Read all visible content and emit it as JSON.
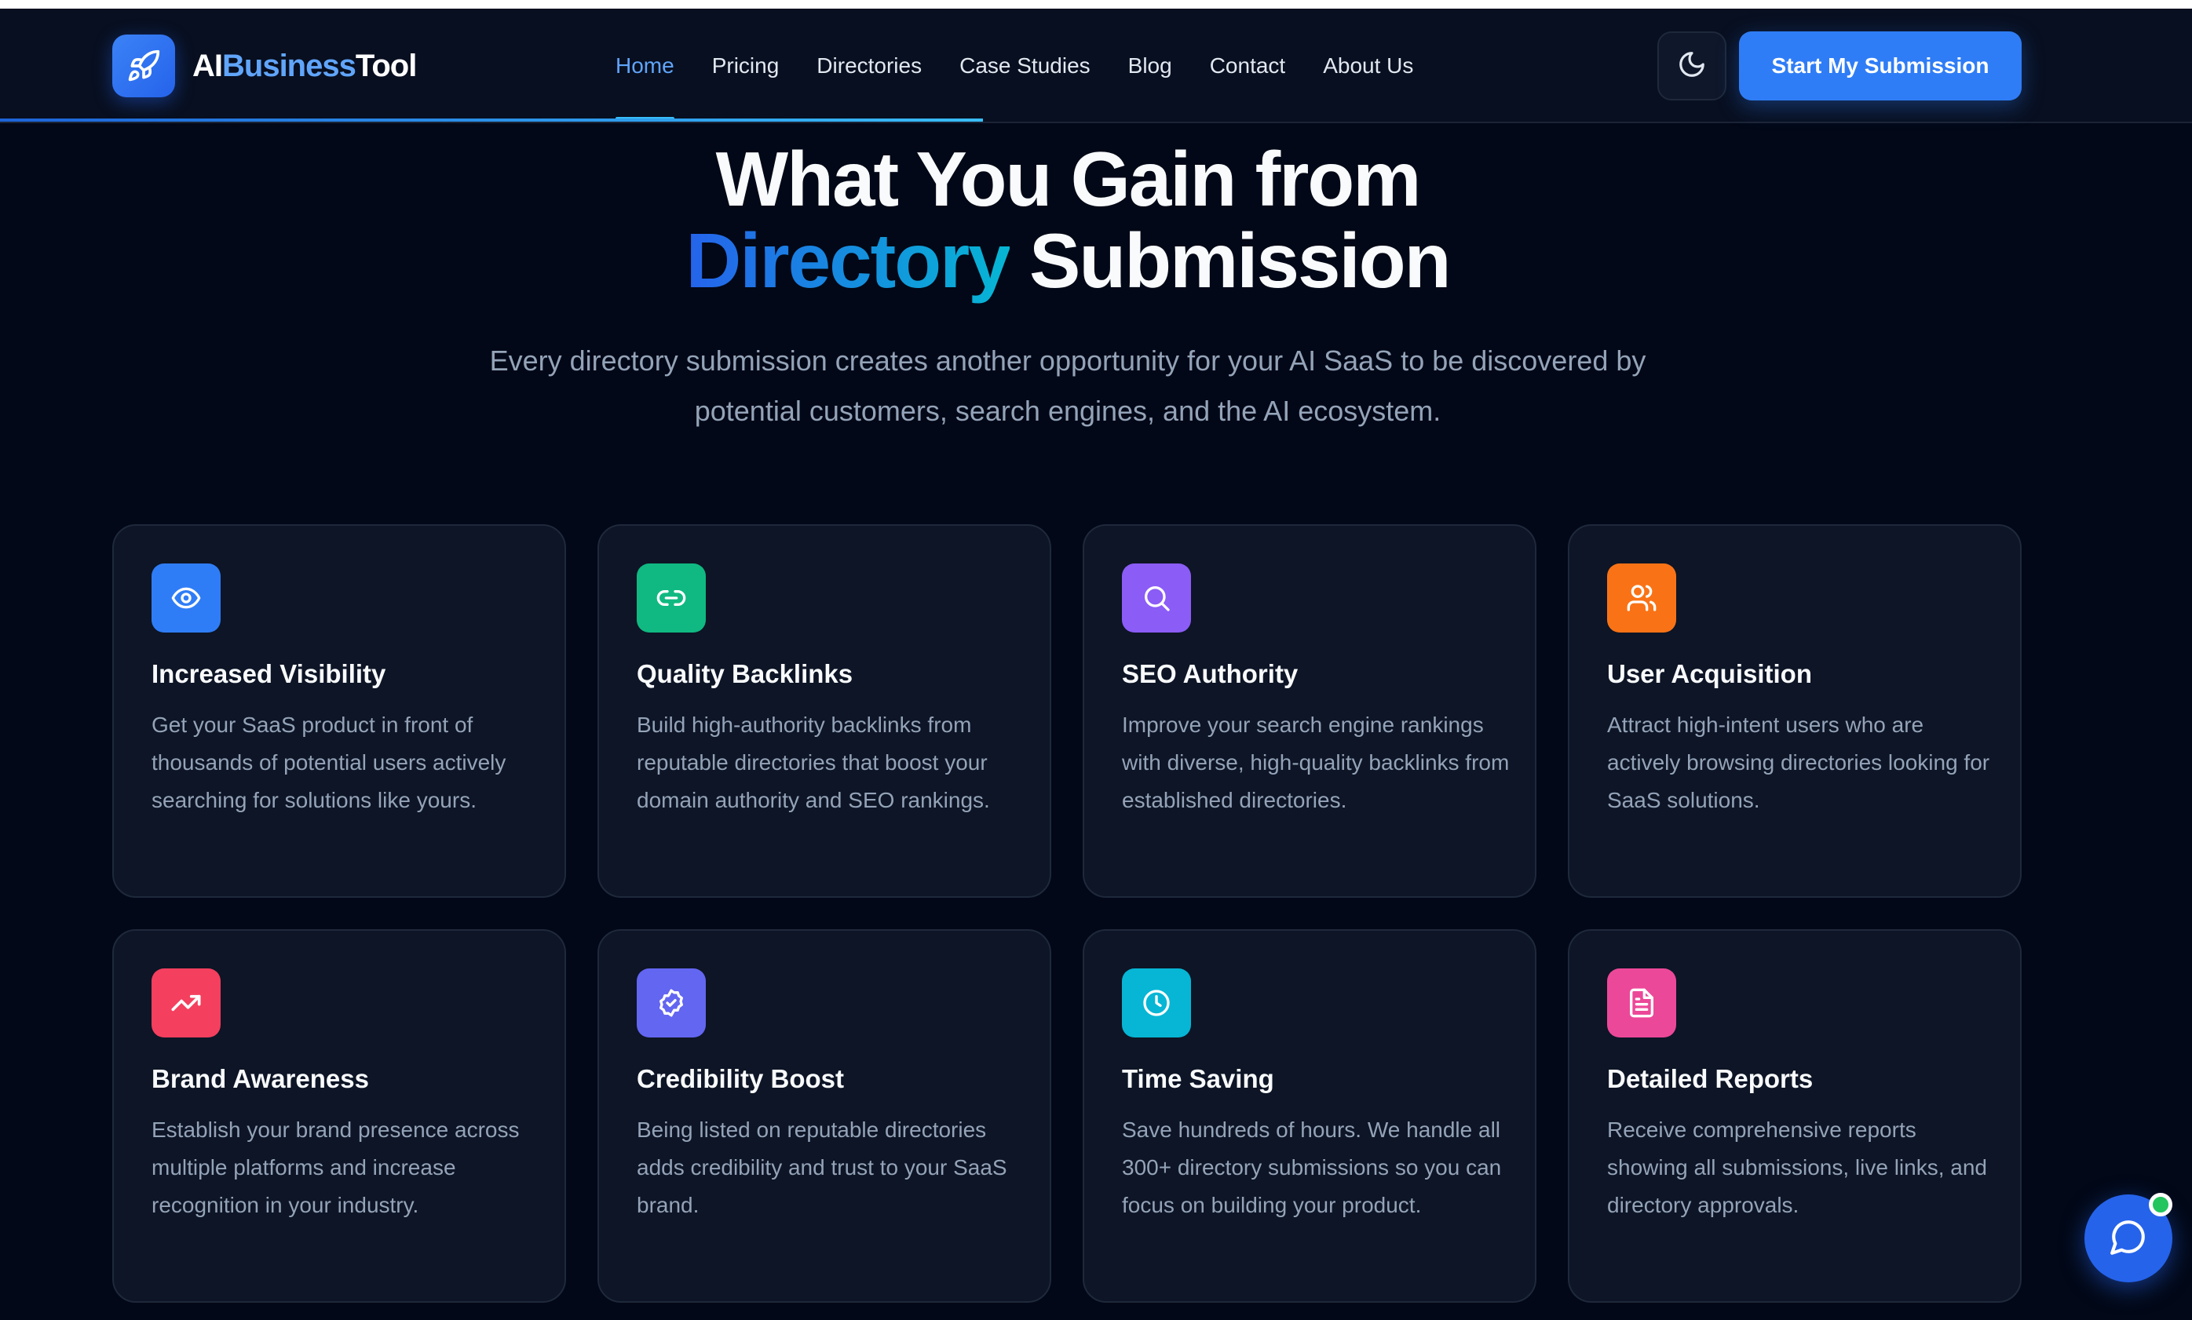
{
  "nav": {
    "logo_part1": "AI",
    "logo_part2": "Business",
    "logo_part3": "Tool",
    "links": [
      "Home",
      "Pricing",
      "Directories",
      "Case Studies",
      "Blog",
      "Contact",
      "About Us"
    ],
    "active_link": "Home",
    "cta_label": "Start My Submission",
    "logo_icon": "rocket-icon",
    "theme_icon": "moon-icon"
  },
  "hero": {
    "title_line1": "What You Gain from",
    "title_accent": "Directory",
    "title_rest": " Submission",
    "subtitle": "Every directory submission creates another opportunity for your AI SaaS to be discovered by potential customers, search engines, and the AI ecosystem."
  },
  "features": [
    {
      "title": "Increased Visibility",
      "desc": "Get your SaaS product in front of thousands of potential users actively searching for solutions like yours.",
      "icon": "eye-icon",
      "color": "#2f7df6"
    },
    {
      "title": "Quality Backlinks",
      "desc": "Build high-authority backlinks from reputable directories that boost your domain authority and SEO rankings.",
      "icon": "link-icon",
      "color": "#10b981"
    },
    {
      "title": "SEO Authority",
      "desc": "Improve your search engine rankings with diverse, high-quality backlinks from established directories.",
      "icon": "search-icon",
      "color": "#8b5cf6"
    },
    {
      "title": "User Acquisition",
      "desc": "Attract high-intent users who are actively browsing directories looking for SaaS solutions.",
      "icon": "users-icon",
      "color": "#f97316"
    },
    {
      "title": "Brand Awareness",
      "desc": "Establish your brand presence across multiple platforms and increase recognition in your industry.",
      "icon": "trending-up-icon",
      "color": "#f43f5e"
    },
    {
      "title": "Credibility Boost",
      "desc": "Being listed on reputable directories adds credibility and trust to your SaaS brand.",
      "icon": "badge-check-icon",
      "color": "#6366f1"
    },
    {
      "title": "Time Saving",
      "desc": "Save hundreds of hours. We handle all 300+ directory submissions so you can focus on building your product.",
      "icon": "clock-icon",
      "color": "#06b6d4"
    },
    {
      "title": "Detailed Reports",
      "desc": "Receive comprehensive reports showing all submissions, live links, and directory approvals.",
      "icon": "document-icon",
      "color": "#ec4899"
    }
  ],
  "chat_widget": {
    "icon": "chat-bubble-icon",
    "status_color": "#22c55e"
  }
}
